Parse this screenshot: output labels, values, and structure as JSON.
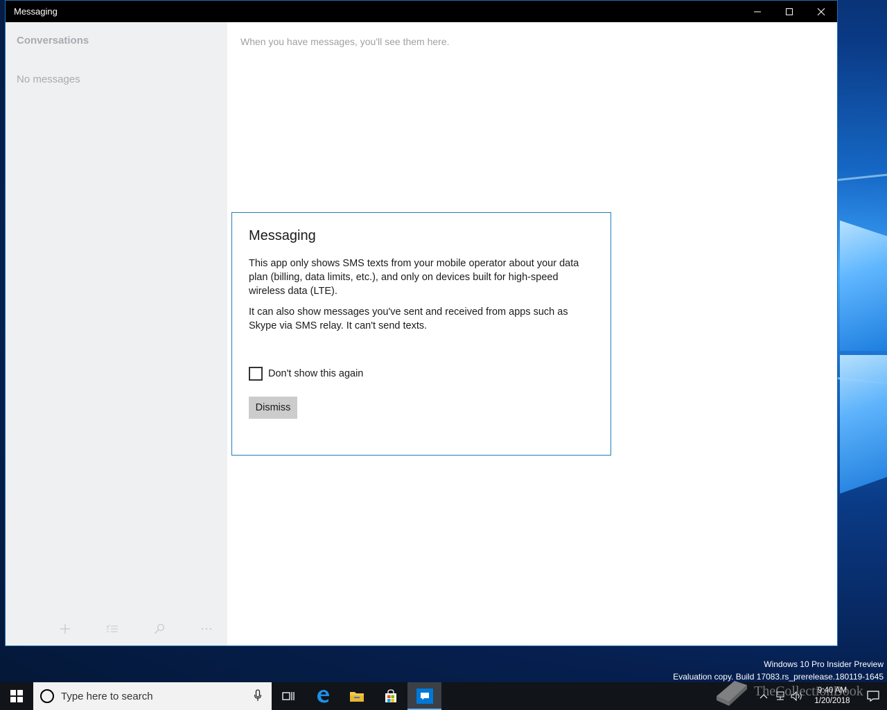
{
  "window": {
    "title": "Messaging",
    "caption": {
      "minimize_icon": "minimize-icon",
      "maximize_icon": "maximize-icon",
      "close_icon": "close-icon"
    }
  },
  "sidebar": {
    "heading": "Conversations",
    "empty_text": "No messages",
    "toolbar": [
      "add-icon",
      "select-icon",
      "search-icon",
      "more-icon"
    ]
  },
  "main": {
    "placeholder": "When you have messages, you'll see them here."
  },
  "dialog": {
    "title": "Messaging",
    "paragraph1": "This app only shows SMS texts from your mobile operator about your data plan (billing, data limits, etc.), and only on devices built for high-speed wireless data (LTE).",
    "paragraph2": "It can also show messages you've sent and received from apps such as Skype via SMS relay. It can't send texts.",
    "checkbox_label": "Don't show this again",
    "checkbox_checked": false,
    "dismiss_label": "Dismiss"
  },
  "desktop": {
    "watermark_line1": "Windows 10 Pro Insider Preview",
    "watermark_line2": "Evaluation copy. Build 17083.rs_prerelease.180119-1645"
  },
  "taskbar": {
    "search_placeholder": "Type here to search",
    "apps": [
      "task-view-icon",
      "edge-icon",
      "file-explorer-icon",
      "store-icon",
      "messaging-icon"
    ],
    "active_app": "messaging-icon",
    "clock_time": "9:40 AM",
    "clock_date": "1/20/2018"
  },
  "overlay": {
    "logo_text": "TheCollectionBook"
  },
  "colors": {
    "accent": "#1a7fb8",
    "titlebar": "#000000",
    "sidebar": "#eef0f2",
    "taskbar": "#111419"
  }
}
